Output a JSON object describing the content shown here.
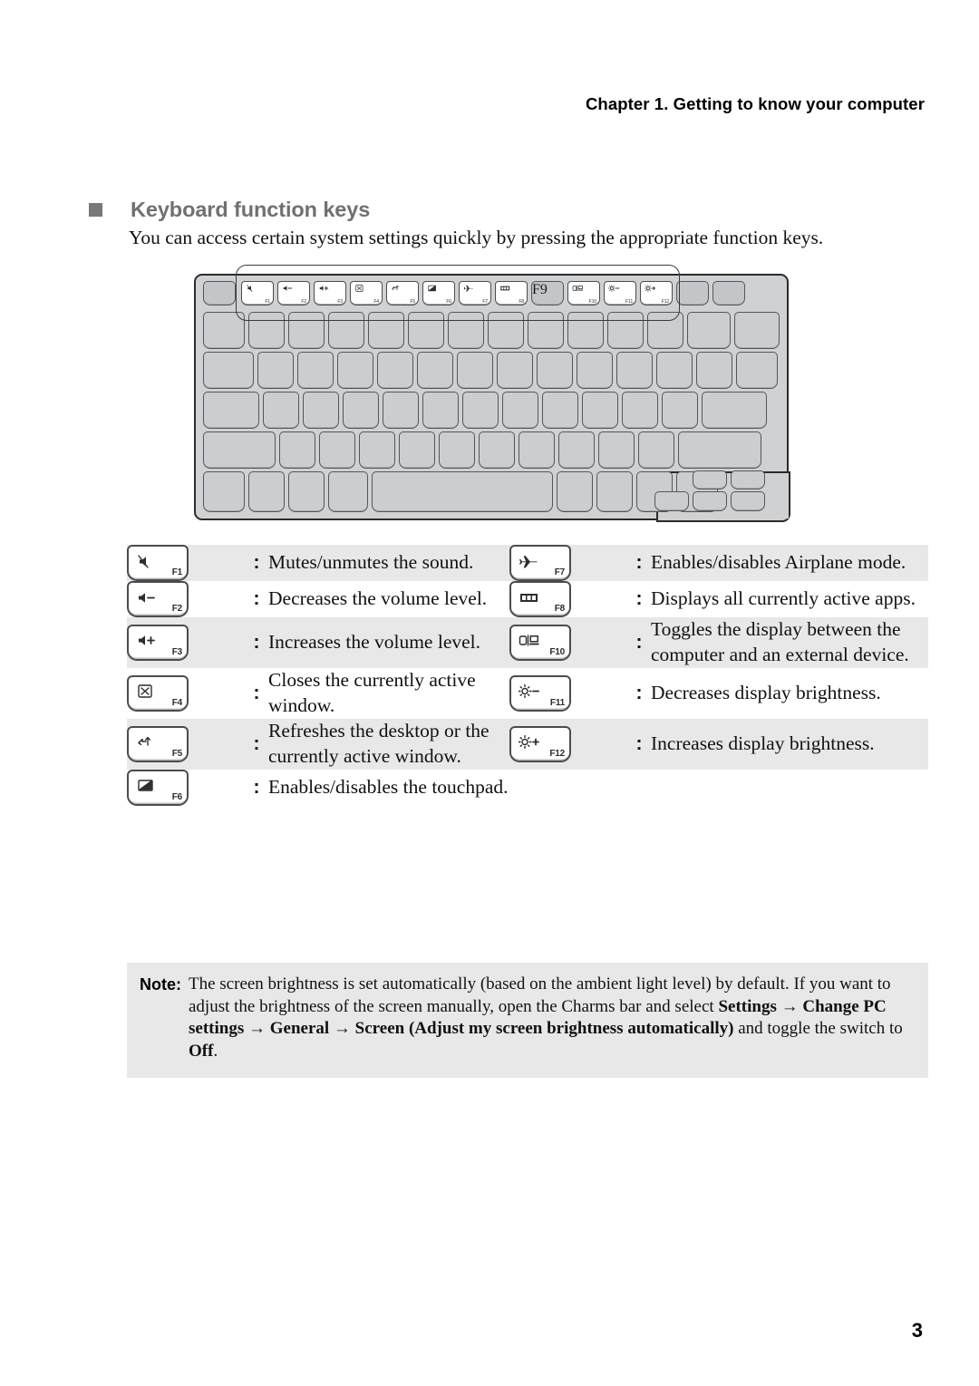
{
  "header": {
    "chapter_title": "Chapter 1. Getting to know your computer"
  },
  "section": {
    "bullet": "square-bullet",
    "heading": "Keyboard function keys",
    "intro": "You can access certain system settings quickly by pressing the appropriate function keys."
  },
  "keyboard_illustration": {
    "callout": "function-key-row-callout",
    "fn_keys": [
      {
        "num": "F1",
        "glyph": "╳",
        "icon": "speaker-mute-icon"
      },
      {
        "num": "F2",
        "glyph": "◁",
        "icon": "volume-down-icon"
      },
      {
        "num": "F3",
        "glyph": "◁",
        "icon": "volume-up-icon"
      },
      {
        "num": "F4",
        "glyph": "⌧",
        "icon": "close-window-icon"
      },
      {
        "num": "F5",
        "glyph": "↺",
        "icon": "refresh-icon"
      },
      {
        "num": "F6",
        "glyph": "▨",
        "icon": "touchpad-toggle-icon"
      },
      {
        "num": "F7",
        "glyph": "✈",
        "icon": "airplane-mode-icon"
      },
      {
        "num": "F8",
        "glyph": "▤",
        "icon": "task-view-icon"
      },
      {
        "num": "F9",
        "glyph": "",
        "icon": "blank-key-icon"
      },
      {
        "num": "F10",
        "glyph": "▭",
        "icon": "display-toggle-icon"
      },
      {
        "num": "F11",
        "glyph": "☀",
        "icon": "brightness-down-icon"
      },
      {
        "num": "F12",
        "glyph": "☀",
        "icon": "brightness-up-icon"
      }
    ]
  },
  "fn_table": {
    "separator": ":",
    "rows": [
      {
        "left": {
          "key": "F1",
          "icon": "speaker-mute-icon",
          "desc": "Mutes/unmutes the sound."
        },
        "right": {
          "key": "F7",
          "icon": "airplane-mode-icon",
          "desc": "Enables/disables Airplane mode."
        },
        "shaded": true
      },
      {
        "left": {
          "key": "F2",
          "icon": "volume-down-icon",
          "desc": "Decreases the volume level."
        },
        "right": {
          "key": "F8",
          "icon": "task-view-icon",
          "desc": "Displays all currently active apps."
        },
        "shaded": false
      },
      {
        "left": {
          "key": "F3",
          "icon": "volume-up-icon",
          "desc": "Increases the volume level."
        },
        "right": {
          "key": "F10",
          "icon": "display-toggle-icon",
          "desc": "Toggles the display between the computer and an external device."
        },
        "shaded": true
      },
      {
        "left": {
          "key": "F4",
          "icon": "close-window-icon",
          "desc": "Closes the currently active window."
        },
        "right": {
          "key": "F11",
          "icon": "brightness-down-icon",
          "desc": "Decreases display brightness."
        },
        "shaded": false
      },
      {
        "left": {
          "key": "F5",
          "icon": "refresh-icon",
          "desc": "Refreshes the desktop or the currently active window."
        },
        "right": {
          "key": "F12",
          "icon": "brightness-up-icon",
          "desc": "Increases display brightness."
        },
        "shaded": true
      },
      {
        "left": {
          "key": "F6",
          "icon": "touchpad-toggle-icon",
          "desc": "Enables/disables the touchpad."
        },
        "right": {
          "key": "",
          "icon": "",
          "desc": ""
        },
        "shaded": false
      }
    ]
  },
  "note": {
    "label": "Note:",
    "text_part1": "The screen brightness is set automatically (based on the ambient light level) by default. If you want to adjust the brightness of the screen manually, open the Charms bar and select ",
    "bold1": "Settings",
    "arrow1": " → ",
    "bold2": "Change PC settings",
    "arrow2": " → ",
    "bold3": "General",
    "arrow3": " → ",
    "bold4": "Screen (Adjust my screen brightness automatically)",
    "text_part2": " and toggle the switch to ",
    "bold5": "Off",
    "text_part3": "."
  },
  "footer": {
    "page_number": "3"
  }
}
